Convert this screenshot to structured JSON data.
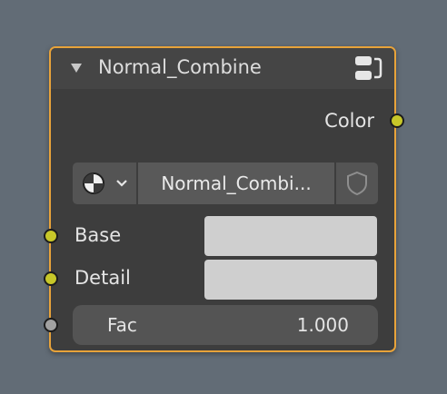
{
  "node": {
    "title": "Normal_Combine",
    "header_icon": "node-group-icon",
    "outputs": [
      {
        "label": "Color",
        "socket_color": "#c7c729"
      }
    ],
    "group_selector": {
      "type_icon": "node-tree-icon",
      "name": "Normal_Combi...",
      "fake_user_icon": "shield-icon"
    },
    "inputs": [
      {
        "label": "Base",
        "socket_color": "#c7c729",
        "value_color": "#cfcfcf"
      },
      {
        "label": "Detail",
        "socket_color": "#c7c729",
        "value_color": "#cfcfcf"
      },
      {
        "label": "Fac",
        "value": "1.000",
        "socket_color": "#a1a1a1"
      }
    ],
    "border_color": "#e8a33a"
  }
}
